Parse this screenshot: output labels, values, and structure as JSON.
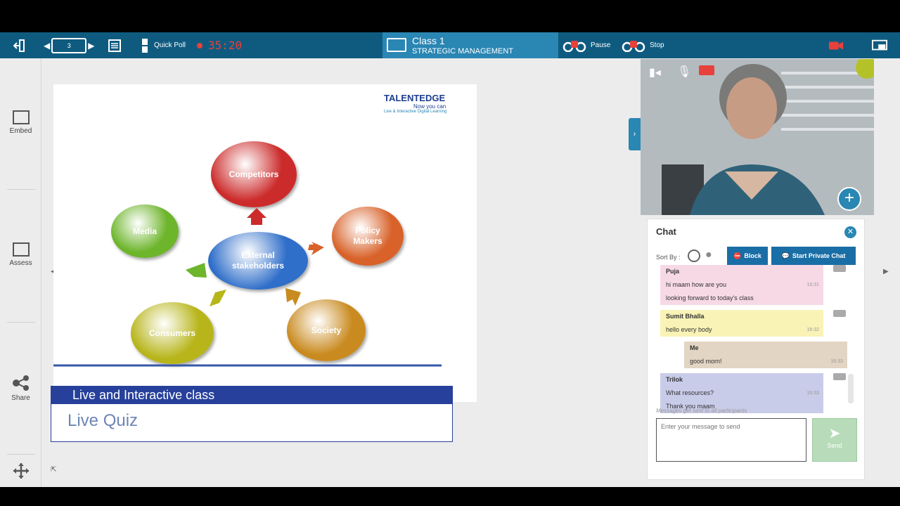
{
  "toolbar": {
    "page_number": "3",
    "quick_poll_label": "Quick Poll",
    "timer": "35:20",
    "class_name": "Class 1",
    "class_subject": "STRATEGIC MANAGEMENT",
    "pause_label": "Pause",
    "stop_label": "Stop"
  },
  "sidebar": {
    "items": [
      {
        "label": "Embed",
        "icon": "embed-icon"
      },
      {
        "label": "Assess",
        "icon": "assess-icon"
      },
      {
        "label": "Share",
        "icon": "share-icon"
      }
    ]
  },
  "slide": {
    "brand_name": "TALENTEDGE",
    "brand_tagline": "Now you can",
    "brand_sub": "Live & Interactive Digital Learning",
    "center": "External stakeholders",
    "nodes": [
      {
        "label": "Competitors",
        "color": "#cc2b2b"
      },
      {
        "label": "Policy Makers",
        "color": "#d8622a"
      },
      {
        "label": "Society",
        "color": "#c98a1f"
      },
      {
        "label": "Consumers",
        "color": "#b7b51a"
      },
      {
        "label": "Media",
        "color": "#6db52b"
      }
    ],
    "center_color": "#2f6ec9"
  },
  "caption": {
    "header": "Live and Interactive class",
    "body": "Live Quiz"
  },
  "chat": {
    "title": "Chat",
    "sort_by": "Sort By :",
    "block_label": "Block",
    "private_chat_label": "Start Private Chat",
    "messages": [
      {
        "sender": "Puja",
        "lines": [
          {
            "text": "hi maam how are you",
            "time": "16:31"
          },
          {
            "text": "looking forward to today's class",
            "time": ""
          }
        ],
        "color": "#f7d9e6"
      },
      {
        "sender": "Sumit Bhalla",
        "lines": [
          {
            "text": "hello every body",
            "time": "16:32"
          }
        ],
        "color": "#f9f3b6"
      },
      {
        "sender": "Me",
        "lines": [
          {
            "text": "good morn!",
            "time": "16:33"
          }
        ],
        "color": "#e3d5c3"
      },
      {
        "sender": "Trilok",
        "lines": [
          {
            "text": "What resources?",
            "time": "16:33"
          },
          {
            "text": "Thank you maam",
            "time": ""
          }
        ],
        "color": "#c9cce9"
      }
    ],
    "notice": "Messages get sent to all participants",
    "input_placeholder": "Enter your message to send",
    "send_label": "Send"
  },
  "colors": {
    "toolbar": "#0f5b80",
    "accent": "#1a6ea6"
  }
}
